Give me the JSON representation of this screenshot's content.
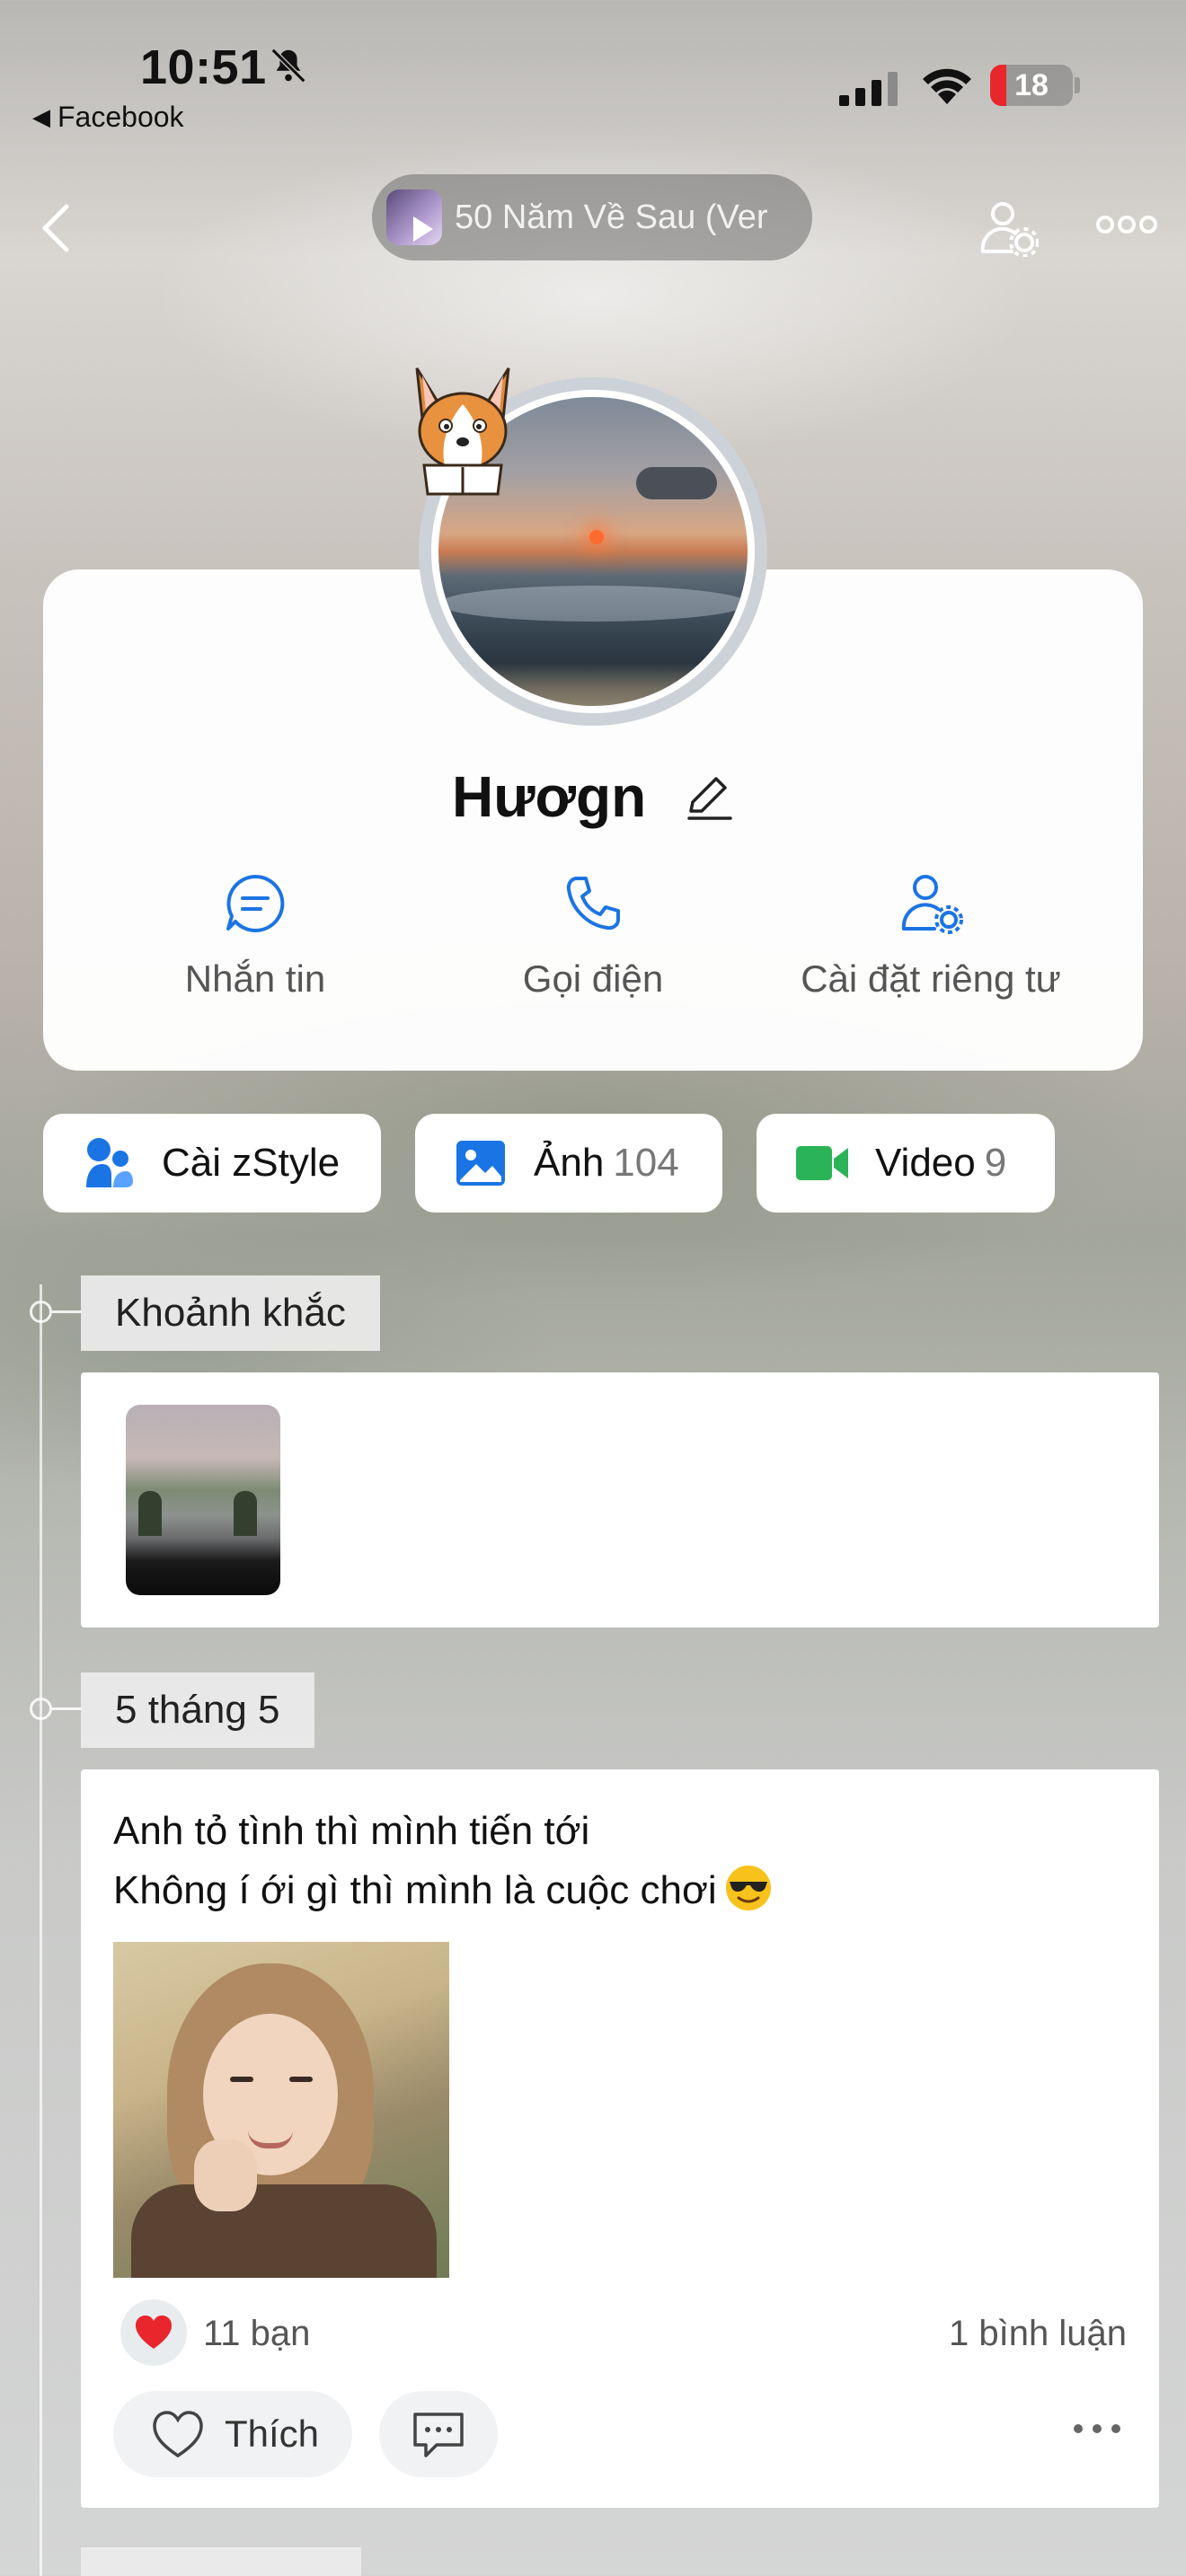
{
  "status_bar": {
    "time": "10:51",
    "back_app": "Facebook",
    "battery": "18",
    "battery_color": "#e8262b"
  },
  "header": {
    "music_title": "50 Năm Về Sau (Ver"
  },
  "profile": {
    "name": "Hươgn",
    "actions": [
      {
        "label": "Nhắn tin",
        "icon": "message-icon"
      },
      {
        "label": "Gọi điện",
        "icon": "phone-icon"
      },
      {
        "label": "Cài đặt riêng tư",
        "icon": "user-settings-icon"
      }
    ],
    "accent_color": "#1b74e4"
  },
  "chips": [
    {
      "label": "Cài zStyle",
      "count": "",
      "icon": "zstyle-icon"
    },
    {
      "label": "Ảnh",
      "count": "104",
      "icon": "photo-icon"
    },
    {
      "label": "Video",
      "count": "9",
      "icon": "video-icon"
    }
  ],
  "timeline": {
    "moments_label": "Khoảnh khắc",
    "date_label": "5 tháng 5"
  },
  "post": {
    "line1": "Anh tỏ tình thì mình tiến tới",
    "line2": "Không í ới gì thì mình là cuộc chơi",
    "reaction_count": "11 bạn",
    "comment_count": "1 bình luận",
    "like_label": "Thích"
  }
}
